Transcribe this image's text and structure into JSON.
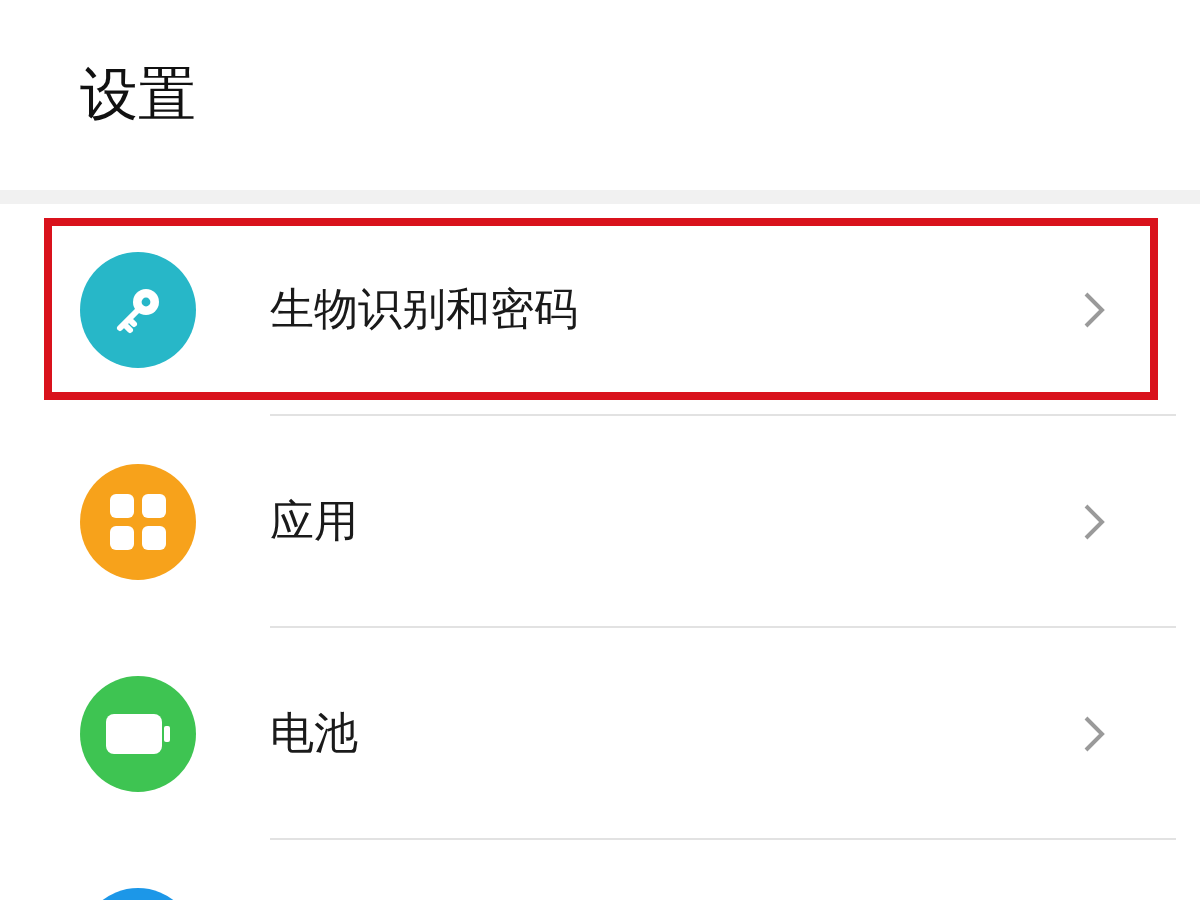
{
  "header": {
    "title": "设置"
  },
  "items": [
    {
      "kind": "key",
      "label": "生物识别和密码",
      "color": "#27b7c8",
      "highlighted": true
    },
    {
      "kind": "apps",
      "label": "应用",
      "color": "#f7a21b",
      "highlighted": false
    },
    {
      "kind": "battery",
      "label": "电池",
      "color": "#3ec452",
      "highlighted": false
    },
    {
      "kind": "other",
      "color": "#1c97e8",
      "highlighted": false
    }
  ]
}
